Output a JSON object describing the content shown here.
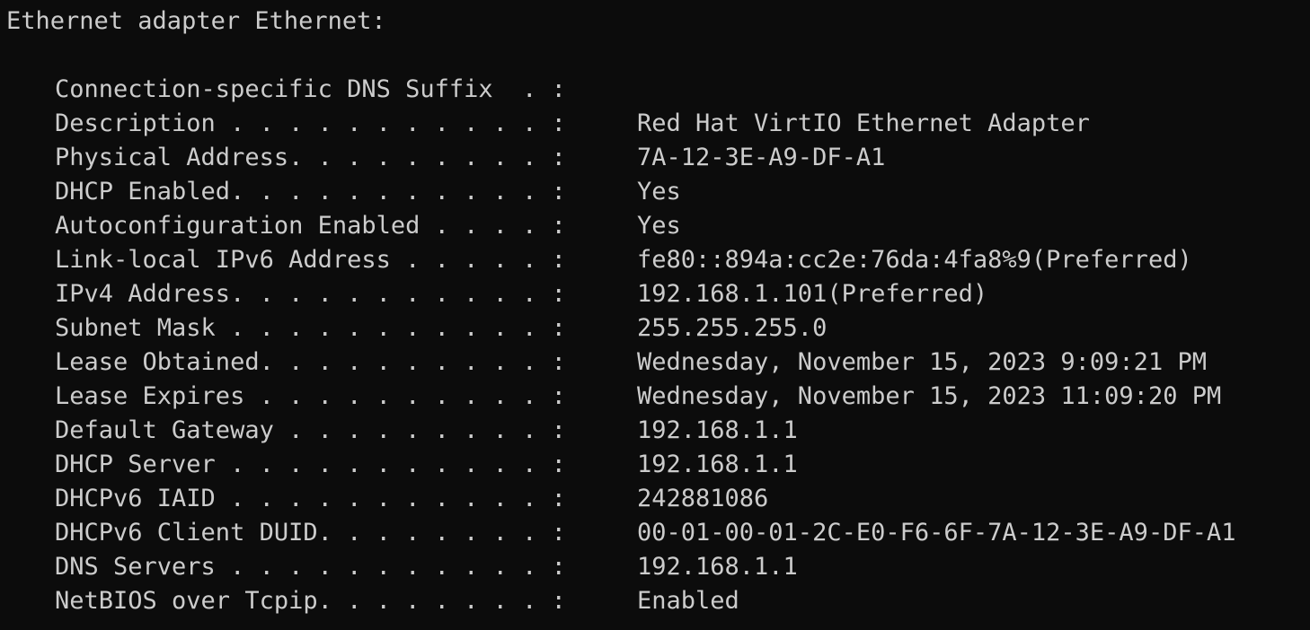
{
  "terminal": {
    "header": "Ethernet adapter Ethernet:",
    "fields": [
      {
        "label": "Connection-specific DNS Suffix  . :",
        "value": ""
      },
      {
        "label": "Description . . . . . . . . . . . :",
        "value": "Red Hat VirtIO Ethernet Adapter"
      },
      {
        "label": "Physical Address. . . . . . . . . :",
        "value": "7A-12-3E-A9-DF-A1"
      },
      {
        "label": "DHCP Enabled. . . . . . . . . . . :",
        "value": "Yes"
      },
      {
        "label": "Autoconfiguration Enabled . . . . :",
        "value": "Yes"
      },
      {
        "label": "Link-local IPv6 Address . . . . . :",
        "value": "fe80::894a:cc2e:76da:4fa8%9(Preferred)"
      },
      {
        "label": "IPv4 Address. . . . . . . . . . . :",
        "value": "192.168.1.101(Preferred)"
      },
      {
        "label": "Subnet Mask . . . . . . . . . . . :",
        "value": "255.255.255.0"
      },
      {
        "label": "Lease Obtained. . . . . . . . . . :",
        "value": "Wednesday, November 15, 2023 9:09:21 PM"
      },
      {
        "label": "Lease Expires . . . . . . . . . . :",
        "value": "Wednesday, November 15, 2023 11:09:20 PM"
      },
      {
        "label": "Default Gateway . . . . . . . . . :",
        "value": "192.168.1.1"
      },
      {
        "label": "DHCP Server . . . . . . . . . . . :",
        "value": "192.168.1.1"
      },
      {
        "label": "DHCPv6 IAID . . . . . . . . . . . :",
        "value": "242881086"
      },
      {
        "label": "DHCPv6 Client DUID. . . . . . . . :",
        "value": "00-01-00-01-2C-E0-F6-6F-7A-12-3E-A9-DF-A1"
      },
      {
        "label": "DNS Servers . . . . . . . . . . . :",
        "value": "192.168.1.1"
      },
      {
        "label": "NetBIOS over Tcpip. . . . . . . . :",
        "value": "Enabled"
      }
    ]
  },
  "colors": {
    "background": "#0c0c0c",
    "foreground": "#cccccc"
  }
}
